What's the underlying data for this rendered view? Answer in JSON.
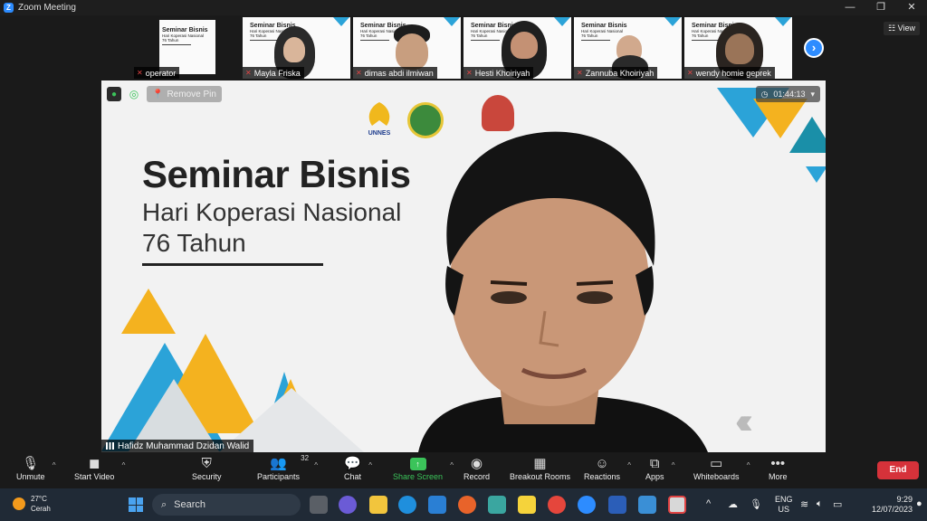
{
  "window": {
    "title": "Zoom Meeting",
    "controls": [
      "—",
      "❐",
      "✕"
    ]
  },
  "gallery": {
    "participants": [
      {
        "name": "operator"
      },
      {
        "name": "Mayla Friska"
      },
      {
        "name": "dimas abdi ilmiwan"
      },
      {
        "name": "Hesti Khoiriyah"
      },
      {
        "name": "Zannuba Khoiriyah"
      },
      {
        "name": "wendy homie geprek"
      }
    ],
    "view_label": "View",
    "next_icon": "chevron-right-icon"
  },
  "slide": {
    "title": "Seminar Bisnis",
    "subtitle": "Hari Koperasi Nasional",
    "years": "76 Tahun",
    "logo_text": "UNNES",
    "colors": {
      "orange": "#f4b21f",
      "blue": "#2ba3d8",
      "teal": "#1a8fa8"
    }
  },
  "mini_slide": {
    "title": "Seminar Bisnis",
    "subtitle": "Hari Koperasi Nasional",
    "years": "76 Tahun"
  },
  "main_video": {
    "remove_pin_label": "Remove Pin",
    "timer": "01:44:13",
    "speaker_name": "Hafidz Muhammad Dzidan Walid"
  },
  "toolbar": {
    "unmute": "Unmute",
    "start_video": "Start Video",
    "security": "Security",
    "participants": "Participants",
    "participants_count": "32",
    "chat": "Chat",
    "share_screen": "Share Screen",
    "record": "Record",
    "breakout_rooms": "Breakout Rooms",
    "reactions": "Reactions",
    "apps": "Apps",
    "whiteboards": "Whiteboards",
    "more": "More",
    "end": "End"
  },
  "taskbar": {
    "temperature": "27°C",
    "weather": "Cerah",
    "search_placeholder": "Search",
    "lang_line1": "ENG",
    "lang_line2": "US",
    "time": "9:29",
    "date": "12/07/2023"
  }
}
